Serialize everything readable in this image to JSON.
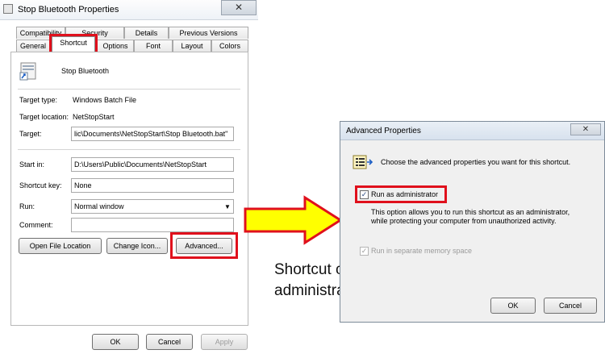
{
  "properties_window": {
    "title": "Stop Bluetooth Properties",
    "close_glyph": "✕",
    "tabs_row1": [
      "Compatibility",
      "Security",
      "Details",
      "Previous Versions"
    ],
    "tabs_row2": [
      "General",
      "Shortcut",
      "Options",
      "Font",
      "Layout",
      "Colors"
    ],
    "active_tab": "Shortcut",
    "shortcut_name": "Stop Bluetooth",
    "target_type_label": "Target type:",
    "target_type_value": "Windows Batch File",
    "target_location_label": "Target location:",
    "target_location_value": "NetStopStart",
    "target_label": "Target:",
    "target_value": "lic\\Documents\\NetStopStart\\Stop Bluetooth.bat\"",
    "start_in_label": "Start in:",
    "start_in_value": "D:\\Users\\Public\\Documents\\NetStopStart",
    "shortcut_key_label": "Shortcut key:",
    "shortcut_key_value": "None",
    "run_label": "Run:",
    "run_value": "Normal window",
    "comment_label": "Comment:",
    "comment_value": "",
    "open_file_location_label": "Open File Location",
    "change_icon_label": "Change Icon...",
    "advanced_label": "Advanced...",
    "ok_label": "OK",
    "cancel_label": "Cancel",
    "apply_label": "Apply"
  },
  "advanced_window": {
    "title": "Advanced Properties",
    "close_glyph": "✕",
    "description": "Choose the advanced properties you want for this shortcut.",
    "run_as_admin_label": "Run as administrator",
    "run_as_admin_checked": true,
    "option_description": "This option allows you to run this shortcut as an administrator, while protecting your computer from unauthorized activity.",
    "separate_memory_label": "Run in separate memory space",
    "separate_memory_checked": true,
    "ok_label": "OK",
    "cancel_label": "Cancel"
  },
  "annotation": {
    "caption": "Shortcut can be run as administrator",
    "highlight_color": "#e0101c",
    "arrow_fill": "#ffff00"
  }
}
